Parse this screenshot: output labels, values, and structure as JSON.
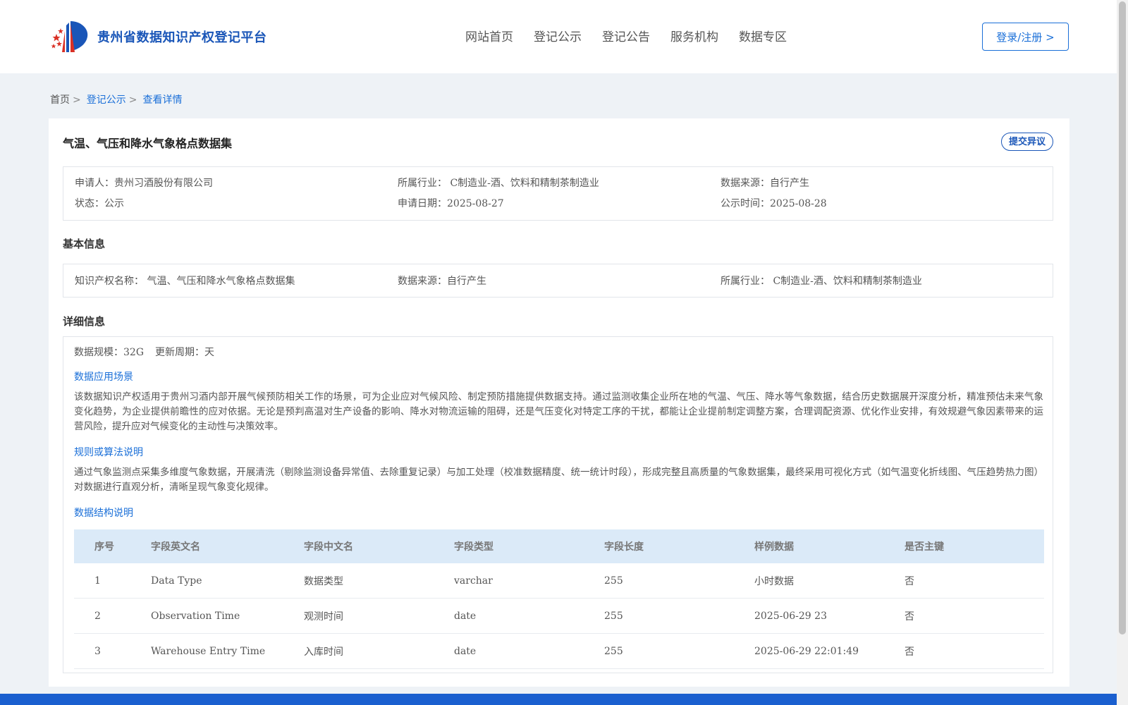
{
  "header": {
    "site_name": "贵州省数据知识产权登记平台",
    "nav": [
      "网站首页",
      "登记公示",
      "登记公告",
      "服务机构",
      "数据专区"
    ],
    "login_label": "登录/注册 >"
  },
  "breadcrumb": {
    "home": "首页",
    "sep": ">",
    "items": [
      "登记公示",
      "查看详情"
    ]
  },
  "detail": {
    "title": "气温、气压和降水气象格点数据集",
    "objection_label": "提交异议",
    "summary": {
      "applicant": "申请人：贵州习酒股份有限公司",
      "industry": "所属行业： C制造业-酒、饮料和精制茶制造业",
      "source": "数据来源：自行产生",
      "status": "状态：公示",
      "apply_date": "申请日期：2025-08-27",
      "publish_date": "公示时间：2025-08-28"
    },
    "basic_title": "基本信息",
    "basic": {
      "ip_name": "知识产权名称： 气温、气压和降水气象格点数据集",
      "source": "数据来源：自行产生",
      "industry": "所属行业： C制造业-酒、饮料和精制茶制造业"
    },
    "detail_title": "详细信息",
    "scale": "数据规模：32G",
    "cycle": "更新周期：天",
    "scene_title": "数据应用场景",
    "scene_text": "该数据知识产权适用于贵州习酒内部开展气候预防相关工作的场景，可为企业应对气候风险、制定预防措施提供数据支持。通过监测收集企业所在地的气温、气压、降水等气象数据，结合历史数据展开深度分析，精准预估未来气象变化趋势，为企业提供前瞻性的应对依据。无论是预判高温对生产设备的影响、降水对物流运输的阻碍，还是气压变化对特定工序的干扰，都能让企业提前制定调整方案，合理调配资源、优化作业安排，有效规避气象因素带来的运营风险，提升应对气候变化的主动性与决策效率。",
    "algo_title": "规则或算法说明",
    "algo_text": "通过气象监测点采集多维度气象数据，开展清洗（剔除监测设备异常值、去除重复记录）与加工处理（校准数据精度、统一统计时段），形成完整且高质量的气象数据集，最终采用可视化方式（如气温变化折线图、气压趋势热力图）对数据进行直观分析，清晰呈现气象变化规律。",
    "struct_title": "数据结构说明",
    "table": {
      "headers": [
        "序号",
        "字段英文名",
        "字段中文名",
        "字段类型",
        "字段长度",
        "样例数据",
        "是否主键"
      ],
      "rows": [
        [
          "1",
          "Data Type",
          "数据类型",
          "varchar",
          "255",
          "小时数据",
          "否"
        ],
        [
          "2",
          "Observation Time",
          "观测时间",
          "date",
          "255",
          "2025-06-29 23",
          "否"
        ],
        [
          "3",
          "Warehouse Entry Time",
          "入库时间",
          "date",
          "255",
          "2025-06-29 22:01:49",
          "否"
        ]
      ]
    }
  },
  "colors": {
    "brand_blue": "#1a56b8",
    "link_blue": "#1a6fd8",
    "table_header_bg": "#dbeaf8",
    "footer_bg": "#1a5fcf"
  }
}
